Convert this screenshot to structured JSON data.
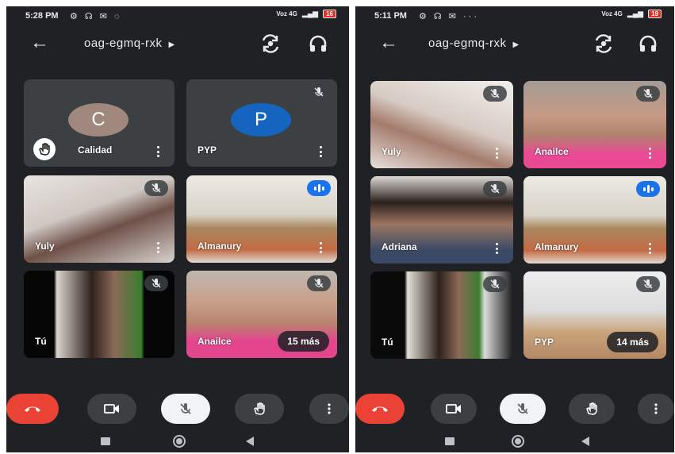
{
  "left": {
    "status": {
      "time": "5:28 PM",
      "net": "Voz 4G",
      "battery": "16"
    },
    "meeting_code": "oag-egmq-rxk",
    "tiles": [
      {
        "name": "Calidad",
        "initial": "C",
        "avatar_color": "#a1887f",
        "state": "hand-raised"
      },
      {
        "name": "PYP",
        "initial": "P",
        "avatar_color": "#1565c0",
        "state": "muted"
      },
      {
        "name": "Yuly",
        "state": "muted"
      },
      {
        "name": "Almanury",
        "state": "speaking"
      },
      {
        "name": "Tú",
        "state": "muted"
      },
      {
        "name": "Anailce",
        "state": "muted",
        "more": "15 más"
      }
    ]
  },
  "right": {
    "status": {
      "time": "5:11 PM",
      "net": "Voz 4G",
      "battery": "19"
    },
    "meeting_code": "oag-egmq-rxk",
    "tiles": [
      {
        "name": "Yuly",
        "state": "muted"
      },
      {
        "name": "Anailce",
        "state": "muted"
      },
      {
        "name": "Adriana",
        "state": "muted"
      },
      {
        "name": "Almanury",
        "state": "speaking"
      },
      {
        "name": "Tú",
        "state": "muted"
      },
      {
        "name": "PYP",
        "state": "muted",
        "more": "14 más"
      }
    ]
  },
  "colors": {
    "background": "#202124",
    "tile": "#3c4043",
    "end_call": "#ea4335",
    "speaking": "#1a73e8"
  }
}
